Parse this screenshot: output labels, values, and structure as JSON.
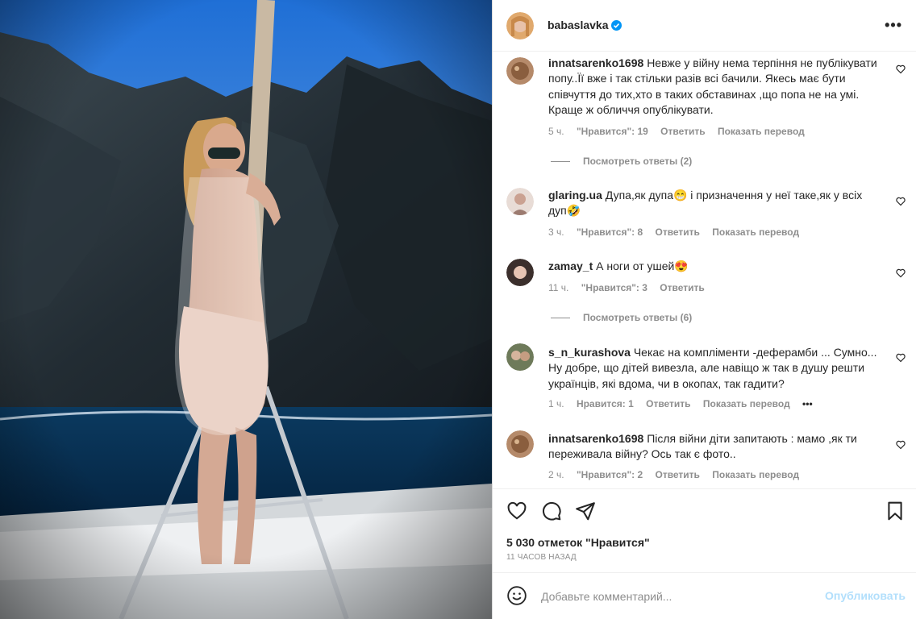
{
  "post": {
    "photo_description_icon": "beach-photo",
    "author": "babaslavka",
    "verified_icon": "verified-badge-icon",
    "more_icon": "more-options-icon",
    "more_label": "•••"
  },
  "comments": [
    {
      "user": "innatsarenko1698",
      "text": "Невже у війну нема терпіння не публікувати попу..Її вже і так стільки разів всі бачили. Якесь має бути співчуття до тих,хто в таких обставинах ,що попа не на умі. Краще ж обличчя опублікувати.",
      "time": "5 ч.",
      "likes": "\"Нравится\": 19",
      "reply": "Ответить",
      "translate": "Показать перевод",
      "view_replies": "Посмотреть ответы (2)"
    },
    {
      "user": "glaring.ua",
      "text": "Дупа,як дупа😁 і призначення у неї таке,як у всіх дуп🤣",
      "time": "3 ч.",
      "likes": "\"Нравится\": 8",
      "reply": "Ответить",
      "translate": "Показать перевод"
    },
    {
      "user": "zamay_t",
      "text": "А ноги от ушей😍",
      "time": "11 ч.",
      "likes": "\"Нравится\": 3",
      "reply": "Ответить",
      "view_replies": "Посмотреть ответы (6)"
    },
    {
      "user": "s_n_kurashova",
      "text": "Чекає на компліменти -деферамби ... Сумно... Ну добре, що дітей вивезла, але навіщо ж так в душу решти українців, які вдома, чи в окопах, так гадити?",
      "time": "1 ч.",
      "likes": "Нравится: 1",
      "reply": "Ответить",
      "translate": "Показать перевод",
      "more": "•••"
    },
    {
      "user": "innatsarenko1698",
      "text": "Після війни діти запитають : мамо ,як ти переживала війну? Ось так є фото..",
      "time": "2 ч.",
      "likes": "\"Нравится\": 2",
      "reply": "Ответить",
      "translate": "Показать перевод"
    }
  ],
  "actions": {
    "like_icon": "heart-icon",
    "comment_icon": "comment-icon",
    "share_icon": "share-icon",
    "save_icon": "bookmark-icon",
    "likes_count": "5 030 отметок \"Нравится\"",
    "time_ago": "11 ЧАСОВ НАЗАД"
  },
  "add_comment": {
    "emoji_icon": "emoji-icon",
    "placeholder": "Добавьте комментарий...",
    "post_label": "Опубликовать"
  },
  "colors": {
    "text": "#262626",
    "secondary": "#8e8e8e",
    "verified": "#0095f6",
    "post_disabled": "#b2dffc"
  }
}
